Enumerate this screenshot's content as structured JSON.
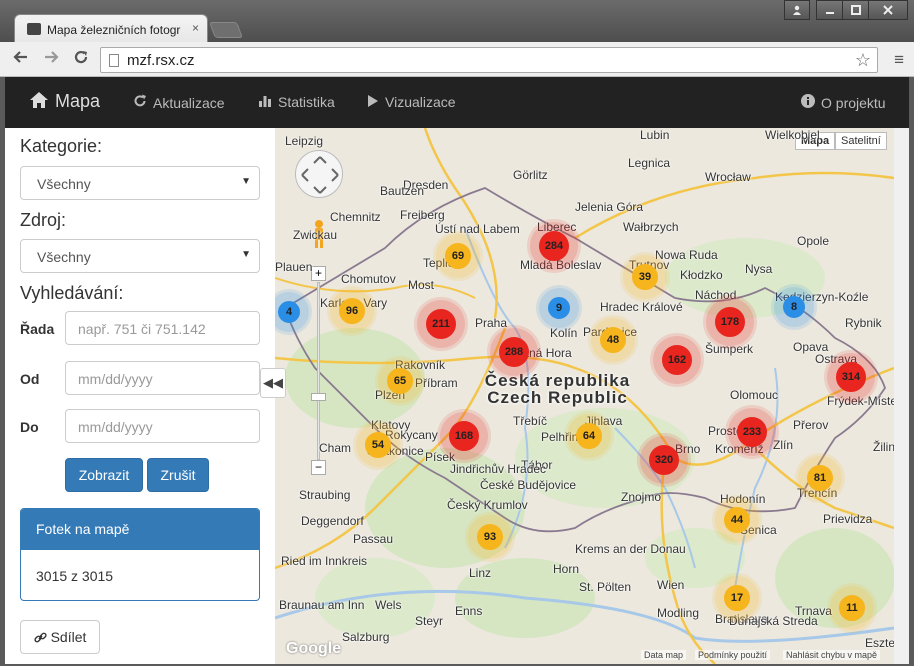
{
  "browser": {
    "tab_title": "Mapa železničních fotogr",
    "tab_close": "×",
    "url": "mzf.rsx.cz",
    "back_icon": "back-arrow-icon",
    "forward_icon": "forward-arrow-icon",
    "reload_icon": "reload-icon"
  },
  "navbar": {
    "brand": "Mapa",
    "items": [
      {
        "label": "Aktualizace",
        "icon": "refresh-icon"
      },
      {
        "label": "Statistika",
        "icon": "bar-chart-icon"
      },
      {
        "label": "Vizualizace",
        "icon": "play-icon"
      }
    ],
    "about": "O projektu"
  },
  "sidebar": {
    "category_label": "Kategorie:",
    "category_value": "Všechny",
    "source_label": "Zdroj:",
    "source_value": "Všechny",
    "search_label": "Vyhledávání:",
    "series_label": "Řada",
    "series_placeholder": "např. 751 či 751.142",
    "from_label": "Od",
    "from_placeholder": "mm/dd/yyyy",
    "to_label": "Do",
    "to_placeholder": "mm/dd/yyyy",
    "show_button": "Zobrazit",
    "cancel_button": "Zrušit",
    "panel_title": "Fotek na mapě",
    "panel_value": "3015 z 3015",
    "share_button": "Sdílet"
  },
  "map": {
    "type_map": "Mapa",
    "type_satellite": "Satelitní",
    "country_cz": "Česká republika",
    "country_en": "Czech Republic",
    "attribution": "Data map",
    "terms": "Podmínky použití",
    "report": "Nahlásit chybu v mapě",
    "logo": "Google",
    "colors": {
      "red": "#e8251f",
      "orange": "#f6b51c",
      "blue": "#2a8ee6"
    },
    "cities": [
      "Leipzig",
      "Dresden",
      "Chemnitz",
      "Zwickau",
      "Plauen",
      "Freiberg",
      "Ústí nad Labem",
      "Teplice",
      "Chomutov",
      "Most",
      "Karlovy Vary",
      "Praha",
      "Kolín",
      "Pardubice",
      "Hradec Králové",
      "Liberec",
      "Mladá Boleslav",
      "Legnica",
      "Wrocław",
      "Jelenia Góra",
      "Wałbrzych",
      "Nowa Ruda",
      "Kłodzko",
      "Opole",
      "Nysa",
      "Kędzierzyn-Koźle",
      "Rybnik",
      "Ostrava",
      "Opava",
      "Šumperk",
      "Olomouc",
      "Frýdek-Místek",
      "Přerov",
      "Prostějov",
      "Zlín",
      "Kroměříž",
      "Brno",
      "Jihlava",
      "Třebíč",
      "Pelhřimov",
      "Tábor",
      "Jindřichův Hradec",
      "České Budějovice",
      "Český Krumlov",
      "Písek",
      "Příbram",
      "Plzeň",
      "Klatovy",
      "Strakonice",
      "Cham",
      "Straubing",
      "Deggendorf",
      "Passau",
      "Linz",
      "Krems an der Donau",
      "St. Pölten",
      "Wien",
      "Bratislava",
      "Trenčín",
      "Prievidza",
      "Hodonín",
      "Znojmo",
      "Salzburg",
      "Lubin",
      "Görlitz",
      "Bautzen",
      "Senica",
      "Trnava",
      "Modling",
      "Dunajská Streda",
      "Ried im Innkreis",
      "Braunau am Inn",
      "Wels",
      "Steyr",
      "Enns",
      "Horn",
      "Žilina",
      "Esztergom",
      "Wielkobiel",
      "Kutná Hora",
      "Rakovník",
      "Náchod",
      "Trutnov",
      "Rokycany"
    ],
    "clusters": [
      {
        "count": "4",
        "color": "blue"
      },
      {
        "count": "96",
        "color": "orange"
      },
      {
        "count": "211",
        "color": "red"
      },
      {
        "count": "69",
        "color": "orange"
      },
      {
        "count": "284",
        "color": "red"
      },
      {
        "count": "9",
        "color": "blue"
      },
      {
        "count": "39",
        "color": "orange"
      },
      {
        "count": "288",
        "color": "red"
      },
      {
        "count": "48",
        "color": "orange"
      },
      {
        "count": "162",
        "color": "red"
      },
      {
        "count": "178",
        "color": "red"
      },
      {
        "count": "8",
        "color": "blue"
      },
      {
        "count": "314",
        "color": "red"
      },
      {
        "count": "65",
        "color": "orange"
      },
      {
        "count": "168",
        "color": "red"
      },
      {
        "count": "64",
        "color": "orange"
      },
      {
        "count": "54",
        "color": "orange"
      },
      {
        "count": "320",
        "color": "red"
      },
      {
        "count": "233",
        "color": "red"
      },
      {
        "count": "81",
        "color": "orange"
      },
      {
        "count": "44",
        "color": "orange"
      },
      {
        "count": "93",
        "color": "orange"
      },
      {
        "count": "17",
        "color": "orange"
      },
      {
        "count": "11",
        "color": "orange"
      }
    ]
  }
}
